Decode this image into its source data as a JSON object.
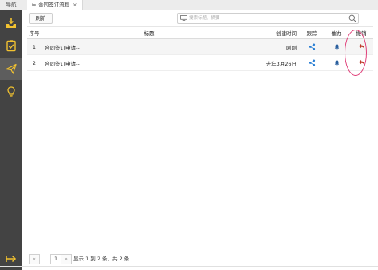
{
  "nav": {
    "title": "导航"
  },
  "tab": {
    "label": "合同签订流程",
    "close": "×"
  },
  "sidebar": {
    "items": [
      "inbox-icon",
      "checklist-icon",
      "paper-plane-icon",
      "lightbulb-icon",
      "exit-icon"
    ]
  },
  "toolbar": {
    "refresh_label": "刷新",
    "search_placeholder": "搜索标题、摘要"
  },
  "table": {
    "headers": {
      "idx": "序号",
      "title": "标题",
      "time": "创建时间",
      "track": "跟踪",
      "urge": "催办",
      "revoke": "撤销"
    },
    "rows": [
      {
        "idx": "1",
        "title": "合同签订申请--",
        "time": "刚刚"
      },
      {
        "idx": "2",
        "title": "合同签订申请--",
        "time": "去年3月26日"
      }
    ]
  },
  "pager": {
    "prev": "«",
    "page": "1",
    "next": "»",
    "info": "显示 1 到 2 条，共 2 条"
  },
  "colors": {
    "accent": "#2a7fd4",
    "sidebar": "#434343",
    "revoke": "#c0392b",
    "annotation": "#e0407a"
  }
}
